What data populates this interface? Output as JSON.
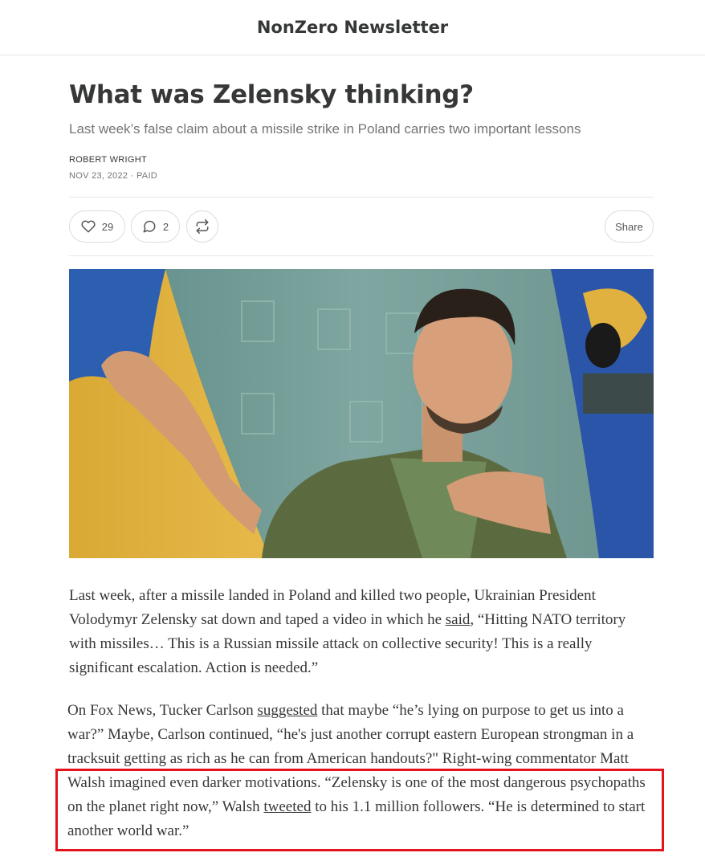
{
  "header": {
    "publication": "NonZero Newsletter"
  },
  "post": {
    "title": "What was Zelensky thinking?",
    "subtitle": "Last week’s false claim about a missile strike in Poland carries two important lessons",
    "author": "ROBERT WRIGHT",
    "meta": "NOV 23, 2022 · PAID"
  },
  "actions": {
    "likes": "29",
    "comments": "2",
    "share_label": "Share"
  },
  "body": {
    "p1": {
      "t1": "Last week, after a missile landed in Poland and killed two people, Ukrainian President Volodymyr Zelensky sat down and taped a video in which he ",
      "link1": "said",
      "t2": ", “Hitting NATO territory with missiles… This is a Russian missile attack on collective security! This is a really significant escalation. Action is needed.”"
    },
    "p2": {
      "t1": "On Fox News, Tucker Carlson ",
      "link1": "suggested",
      "t2": " that maybe “he’s lying on purpose to get us into a war?” Maybe, Carlson continued, “he's just another corrupt eastern European strongman in a tracksuit getting as rich as he can from American handouts?\" Right-wing commentator Matt Walsh imagined even darker motivations. “Zelensky is one of the most dangerous psychopaths on the planet right now,” Walsh ",
      "link2": "tweeted",
      "t3": " to his 1.1 million followers. “He is determined to start another world war.”"
    }
  },
  "colors": {
    "highlight": "#e3121d",
    "text": "#363737",
    "muted": "#757575"
  },
  "icons": [
    "heart-icon",
    "comment-icon",
    "restack-icon"
  ]
}
